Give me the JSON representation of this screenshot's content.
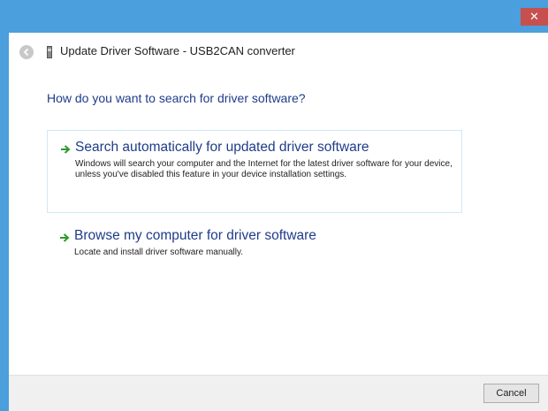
{
  "window": {
    "title": "Update Driver Software - USB2CAN converter",
    "close_label": "✕"
  },
  "main": {
    "question": "How do you want to search for driver software?",
    "options": [
      {
        "title": "Search automatically for updated driver software",
        "description": "Windows will search your computer and the Internet for the latest driver software for your device, unless you've disabled this feature in your device installation settings."
      },
      {
        "title": "Browse my computer for driver software",
        "description": "Locate and install driver software manually."
      }
    ]
  },
  "footer": {
    "cancel_label": "Cancel"
  },
  "colors": {
    "accent": "#4a9fdc",
    "link_blue": "#1f3c8a",
    "arrow_green": "#2e9a2e",
    "close_red": "#c7504f"
  },
  "icons": {
    "back": "back-arrow-icon",
    "device": "usb-device-icon",
    "option_arrow": "green-arrow-icon",
    "close": "close-icon"
  }
}
